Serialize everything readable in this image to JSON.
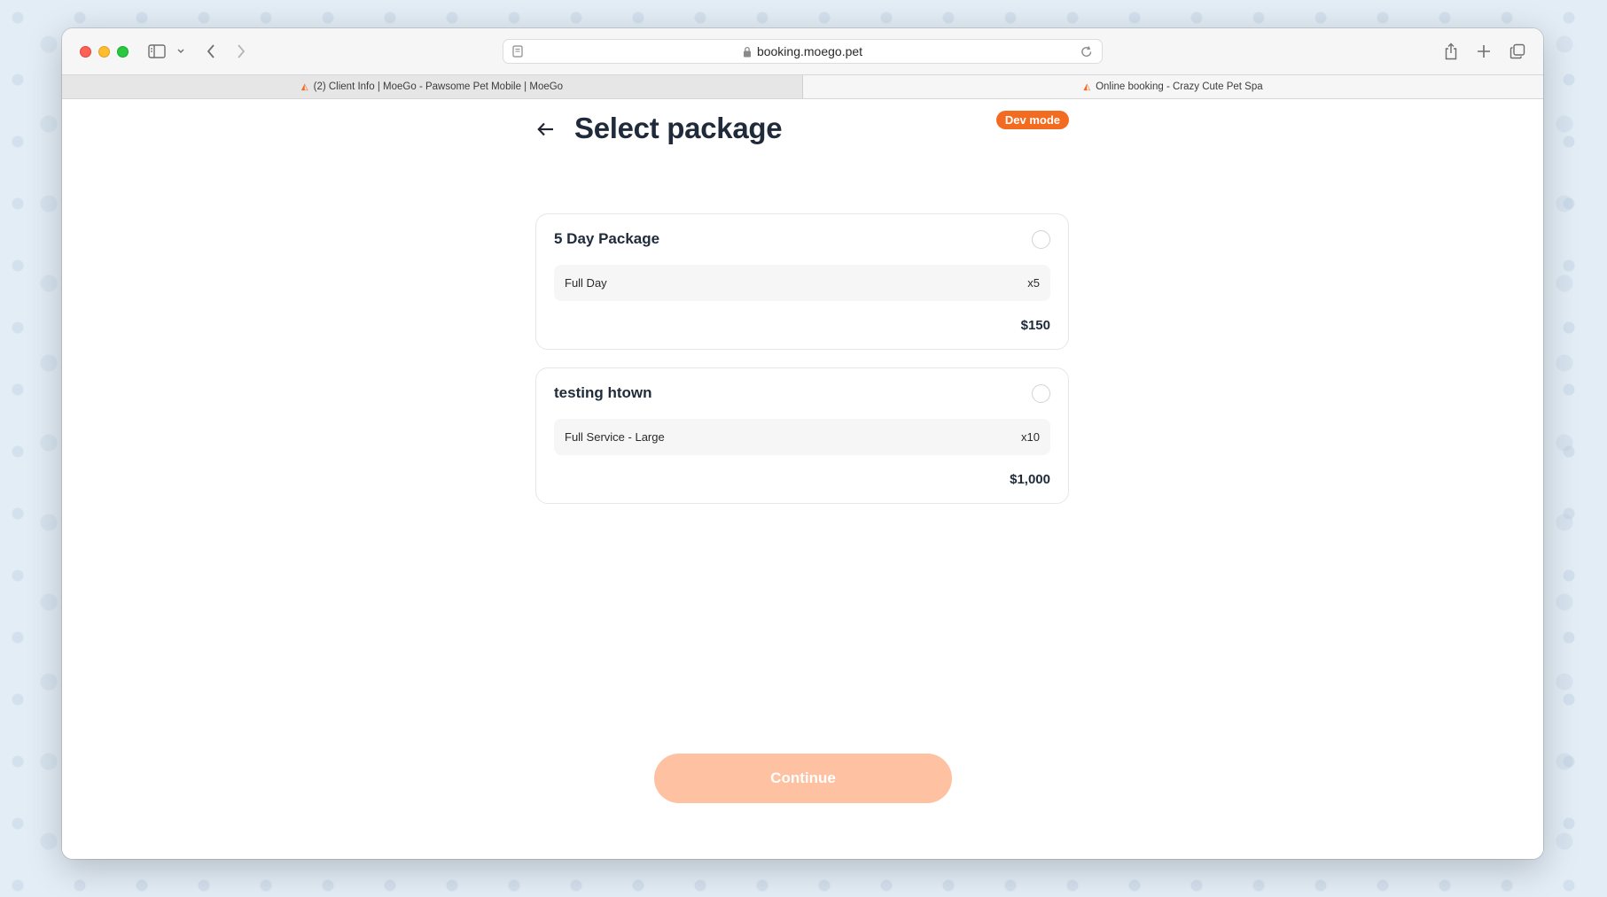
{
  "browser": {
    "url": "booking.moego.pet",
    "tabs": [
      {
        "label": "(2) Client Info | MoeGo - Pawsome Pet Mobile | MoeGo"
      },
      {
        "label": "Online booking - Crazy Cute Pet Spa"
      }
    ]
  },
  "page": {
    "title": "Select package",
    "badge": "Dev mode",
    "continue_label": "Continue"
  },
  "packages": [
    {
      "name": "5 Day Package",
      "service": "Full Day",
      "qty": "x5",
      "price": "$150"
    },
    {
      "name": "testing htown",
      "service": "Full Service - Large",
      "qty": "x10",
      "price": "$1,000"
    }
  ],
  "colors": {
    "accent": "#f36b21",
    "button_disabled": "#fec1a1"
  }
}
